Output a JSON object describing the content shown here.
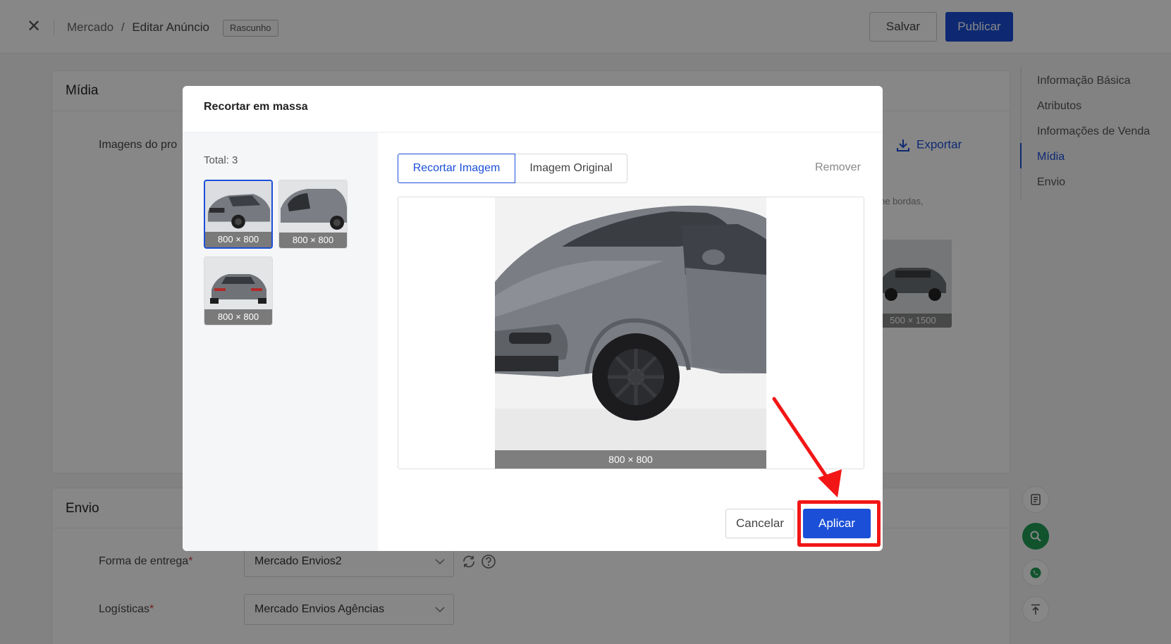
{
  "topbar": {
    "breadcrumb_root": "Mercado",
    "breadcrumb_sep": "/",
    "breadcrumb_current": "Editar Anúncio",
    "status_badge": "Rascunho",
    "save_label": "Salvar",
    "publish_label": "Publicar"
  },
  "media_section": {
    "title": "Mídia",
    "images_label": "Imagens do pro",
    "export_label": "Exportar",
    "hint_fragment": "ne bordas,",
    "bg_thumb_label": "500 × 1500"
  },
  "shipping_section": {
    "title": "Envio",
    "delivery_label": "Forma de entrega",
    "delivery_value": "Mercado Envios2",
    "logistics_label": "Logísticas",
    "logistics_value": "Mercado Envios Agências",
    "required_mark": "*"
  },
  "anchor_nav": {
    "items": [
      {
        "label": "Informação Básica",
        "active": false
      },
      {
        "label": "Atributos",
        "active": false
      },
      {
        "label": "Informações de Venda",
        "active": false
      },
      {
        "label": "Mídia",
        "active": true
      },
      {
        "label": "Envio",
        "active": false
      }
    ]
  },
  "modal": {
    "title": "Recortar em massa",
    "total_label": "Total: 3",
    "thumbnails": [
      {
        "size": "800 × 800",
        "selected": true
      },
      {
        "size": "800 × 800",
        "selected": false
      },
      {
        "size": "800 × 800",
        "selected": false
      }
    ],
    "tab_crop": "Recortar Imagem",
    "tab_original": "Imagem Original",
    "remove_label": "Remover",
    "preview_size": "800 × 800",
    "cancel_label": "Cancelar",
    "apply_label": "Aplicar"
  },
  "colors": {
    "primary": "#1b4fd8",
    "annotation": "#f21616",
    "overlay": "rgba(0,0,0,0.47)",
    "whatsapp_green": "#1f9d55"
  }
}
